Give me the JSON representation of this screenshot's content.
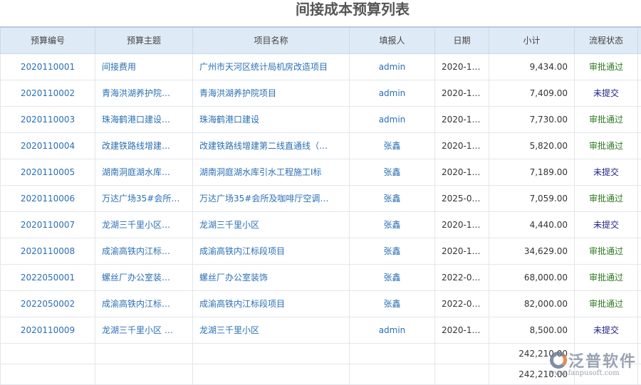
{
  "title": "间接成本预算列表",
  "columns": [
    "预算编号",
    "预算主题",
    "项目名称",
    "填报人",
    "日期",
    "小计",
    "流程状态"
  ],
  "rows": [
    [
      "2020110001",
      "间接费用",
      "广州市天河区统计局机房改造项目",
      "admin",
      "2020-1…",
      "9,434.00",
      "审批通过"
    ],
    [
      "2020110002",
      "青海洪湖养护院…",
      "青海洪湖养护院项目",
      "admin",
      "2020-1…",
      "7,409.00",
      "未提交"
    ],
    [
      "2020110003",
      "珠海鹤港口建设…",
      "珠海鹤港口建设",
      "admin",
      "2020-1…",
      "7,730.00",
      "审批通过"
    ],
    [
      "2020110004",
      "改建铁路线增建…",
      "改建铁路线增建第二线直通线（…",
      "张鑫",
      "2020-1…",
      "5,820.00",
      "审批通过"
    ],
    [
      "2020110005",
      "湖南洞庭湖水库…",
      "湖南洞庭湖水库引水工程施工I标",
      "张鑫",
      "2020-1…",
      "7,189.00",
      "未提交"
    ],
    [
      "2020110006",
      "万达广场35#会所…",
      "万达广场35#会所及咖啡厅空调…",
      "张鑫",
      "2025-0…",
      "7,059.00",
      "审批通过"
    ],
    [
      "2020110007",
      "龙湖三千里小区…",
      "龙湖三千里小区",
      "张鑫",
      "2020-1…",
      "4,440.00",
      "未提交"
    ],
    [
      "2020110008",
      "成渝高铁内江标…",
      "成渝高铁内江标段项目",
      "张鑫",
      "2020-1…",
      "34,629.00",
      "审批通过"
    ],
    [
      "2022050001",
      "螺丝厂办公室装…",
      "螺丝厂办公室装饰",
      "张鑫",
      "2022-0…",
      "68,000.00",
      "审批通过"
    ],
    [
      "2022050002",
      "成渝高铁内江标…",
      "成渝高铁内江标段项目",
      "张鑫",
      "2022-0…",
      "82,000.00",
      "审批通过"
    ],
    [
      "2020110009",
      "龙湖三千里小区 …",
      "龙湖三千里小区",
      "admin",
      "2020-1…",
      "8,500.00",
      "未提交"
    ]
  ],
  "totals": [
    "242,210.00",
    "242,210.00"
  ],
  "watermark": {
    "name": "泛普软件",
    "url": "www.fanpusoft.com"
  },
  "colors": {
    "approved": "#2b7a1e",
    "unsubmitted": "#22228a",
    "link": "#2a6fb5"
  }
}
